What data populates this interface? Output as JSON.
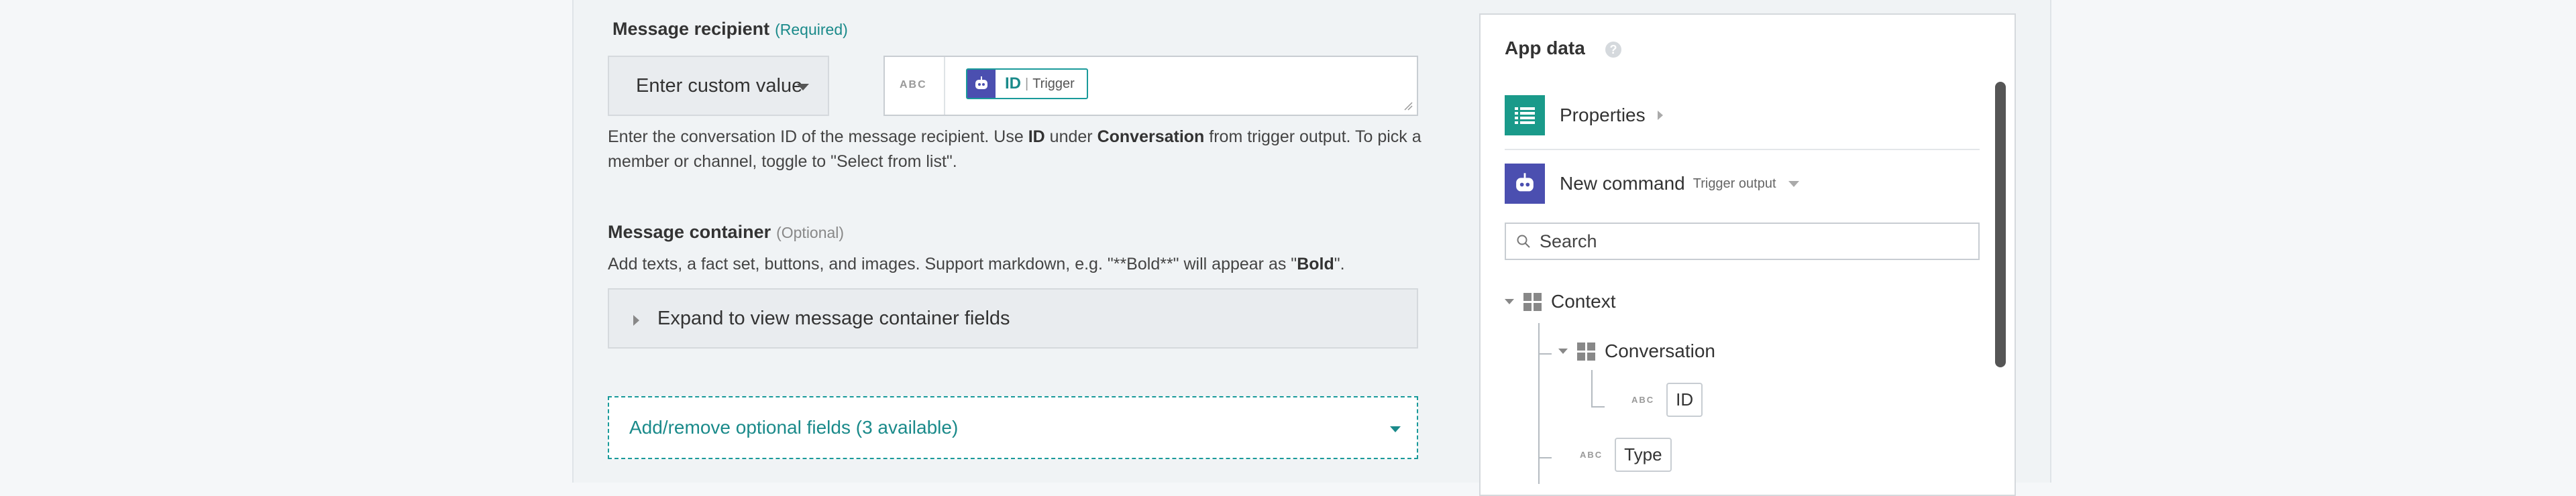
{
  "recipient": {
    "label": "Message recipient",
    "required_tag": "(Required)",
    "select_value": "Enter custom value",
    "input_type": "ABC",
    "pill_id": "ID",
    "pill_sep": "|",
    "pill_source": "Trigger",
    "help_1": "Enter the conversation ID of the message recipient. Use ",
    "help_b1": "ID",
    "help_2": " under ",
    "help_b2": "Conversation",
    "help_3": " from trigger output. To pick a member or channel, toggle to \"Select from list\"."
  },
  "container": {
    "label": "Message container",
    "optional_tag": "(Optional)",
    "help_1": "Add texts, a fact set, buttons, and images. Support markdown, e.g. \"**Bold**\" will appear as \"",
    "help_b": "Bold",
    "help_2": "\".",
    "expand_label": "Expand to view message container fields"
  },
  "optional_fields": {
    "label": "Add/remove optional fields (3 available)"
  },
  "app_data": {
    "title": "App data",
    "help_icon": "?",
    "properties_label": "Properties",
    "command_label": "New command",
    "command_tag": "Trigger output",
    "search_placeholder": "Search",
    "tree": {
      "context": "Context",
      "conversation": "Conversation",
      "id_type": "ABC",
      "id": "ID",
      "type_type": "ABC",
      "type": "Type"
    }
  },
  "colors": {
    "accent": "#1a9a9a",
    "bot": "#4b4fb0"
  }
}
